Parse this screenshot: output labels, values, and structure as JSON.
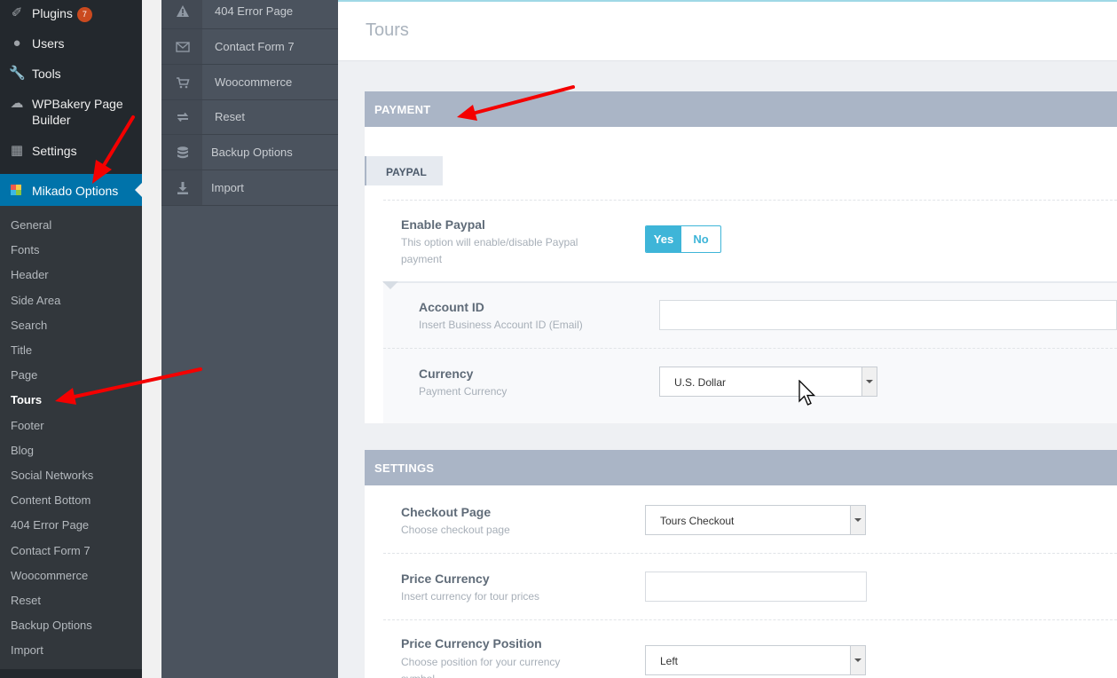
{
  "wp_menu": {
    "items": [
      {
        "label": "Plugins",
        "badge": "7",
        "icon": "plugin-icon"
      },
      {
        "label": "Users",
        "icon": "users-icon"
      },
      {
        "label": "Tools",
        "icon": "tools-icon"
      },
      {
        "label": "WPBakery Page Builder",
        "icon": "wpbakery-cloud-icon"
      },
      {
        "label": "Settings",
        "icon": "settings-icon"
      }
    ],
    "active": {
      "label": "Mikado Options",
      "icon": "mikado-logo-icon"
    },
    "submenu": [
      "General",
      "Fonts",
      "Header",
      "Side Area",
      "Search",
      "Title",
      "Page",
      "Tours",
      "Footer",
      "Blog",
      "Social Networks",
      "Content Bottom",
      "404 Error Page",
      "Contact Form 7",
      "Woocommerce",
      "Reset",
      "Backup Options",
      "Import"
    ],
    "current_submenu": "Tours"
  },
  "options_nav": [
    {
      "label": "404 Error Page",
      "icon": "warning-icon"
    },
    {
      "label": "Contact Form 7",
      "icon": "envelope-icon"
    },
    {
      "label": "Woocommerce",
      "icon": "cart-icon"
    },
    {
      "label": "Reset",
      "icon": "reset-icon"
    },
    {
      "label": "Backup Options",
      "icon": "database-icon"
    },
    {
      "label": "Import",
      "icon": "download-icon"
    }
  ],
  "page": {
    "title": "Tours"
  },
  "payment": {
    "section_title": "PAYMENT",
    "subtab": "PAYPAL",
    "enable_paypal": {
      "title": "Enable Paypal",
      "desc_line1": "This option will enable/disable Paypal",
      "desc_line2": "payment",
      "yes": "Yes",
      "no": "No",
      "value": "Yes"
    },
    "account_id": {
      "title": "Account ID",
      "desc": "Insert Business Account ID (Email)",
      "value": ""
    },
    "currency": {
      "title": "Currency",
      "desc": "Payment Currency",
      "value": "U.S. Dollar"
    }
  },
  "settings": {
    "section_title": "SETTINGS",
    "checkout_page": {
      "title": "Checkout Page",
      "desc": "Choose checkout page",
      "value": "Tours Checkout"
    },
    "price_currency": {
      "title": "Price Currency",
      "desc": "Insert currency for tour prices",
      "value": ""
    },
    "price_currency_position": {
      "title": "Price Currency Position",
      "desc_line1": "Choose position for your currency",
      "desc_line2": "symbol",
      "value": "Left"
    }
  },
  "colors": {
    "wp_active": "#0073aa",
    "section_bar": "#aab5c6",
    "toggle_accent": "#3eb5d8",
    "arrow": "#ff0000"
  }
}
